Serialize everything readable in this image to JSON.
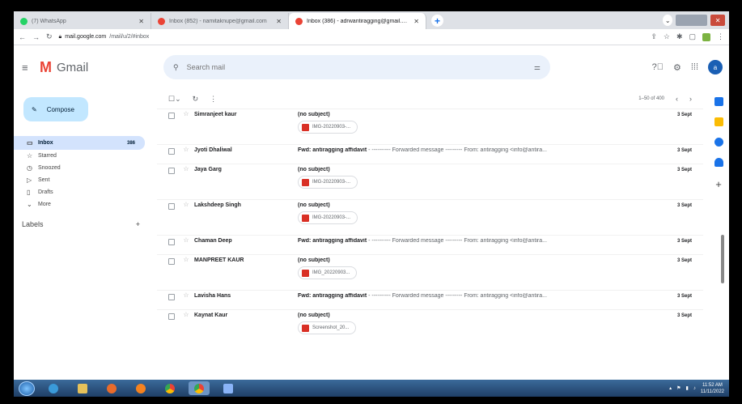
{
  "browser": {
    "tabs": [
      {
        "title": "(7) WhatsApp",
        "favicon_color": "#25d366",
        "active": false
      },
      {
        "title": "Inbox (852) - namitaknupe@gmail.com",
        "favicon_color": "#ea4335",
        "active": false
      },
      {
        "title": "Inbox (386) - adrwantiragging@gmail.com",
        "favicon_color": "#ea4335",
        "active": true
      }
    ],
    "new_tab": "+",
    "url_host": "mail.google.com",
    "url_path": "/mail/u/2/#inbox"
  },
  "gmail": {
    "app_name": "Gmail",
    "search_placeholder": "Search mail",
    "avatar_letter": "a",
    "compose_label": "Compose",
    "nav": [
      {
        "label": "Inbox",
        "count": "386",
        "icon": "inbox-icon",
        "glyph": "▭",
        "selected": true
      },
      {
        "label": "Starred",
        "count": "",
        "icon": "star-icon",
        "glyph": "☆",
        "selected": false
      },
      {
        "label": "Snoozed",
        "count": "",
        "icon": "clock-icon",
        "glyph": "◷",
        "selected": false
      },
      {
        "label": "Sent",
        "count": "",
        "icon": "send-icon",
        "glyph": "▷",
        "selected": false
      },
      {
        "label": "Drafts",
        "count": "",
        "icon": "draft-icon",
        "glyph": "▯",
        "selected": false
      },
      {
        "label": "More",
        "count": "",
        "icon": "chevron-down-icon",
        "glyph": "⌄",
        "selected": false
      }
    ],
    "labels_heading": "Labels",
    "labels_add": "+",
    "pager": "1–50 of 400",
    "emails": [
      {
        "sender": "Simranjeet kaur",
        "subject": "(no subject)",
        "snippet": "",
        "attachment": "IMG-20220903-...",
        "date": "3 Sept"
      },
      {
        "sender": "Jyoti Dhaliwal",
        "subject": "Fwd: antiragging affidavit",
        "snippet": " - ---------- Forwarded message --------- From: antiragging <info@antira...",
        "attachment": "",
        "date": "3 Sept"
      },
      {
        "sender": "Jaya Garg",
        "subject": "(no subject)",
        "snippet": "",
        "attachment": "IMG-20220903-...",
        "date": "3 Sept"
      },
      {
        "sender": "Lakshdeep Singh",
        "subject": "(no subject)",
        "snippet": "",
        "attachment": "IMG-20220903-...",
        "date": "3 Sept"
      },
      {
        "sender": "Chaman Deep",
        "subject": "Fwd: antiragging affidavit",
        "snippet": " - ---------- Forwarded message --------- From: antiragging <info@antira...",
        "attachment": "",
        "date": "3 Sept"
      },
      {
        "sender": "MANPREET KAUR",
        "subject": "(no subject)",
        "snippet": "",
        "attachment": "IMG_20220903...",
        "date": "3 Sept"
      },
      {
        "sender": "Lavisha Hans",
        "subject": "Fwd: antiragging affidavit",
        "snippet": " - ---------- Forwarded message --------- From: antiragging <info@antira...",
        "attachment": "",
        "date": "3 Sept"
      },
      {
        "sender": "Kaynat Kaur",
        "subject": "(no subject)",
        "snippet": "",
        "attachment": "Screenshot_20...",
        "date": "3 Sept"
      }
    ]
  },
  "taskbar": {
    "time": "11:52 AM",
    "date": "11/11/2022"
  }
}
